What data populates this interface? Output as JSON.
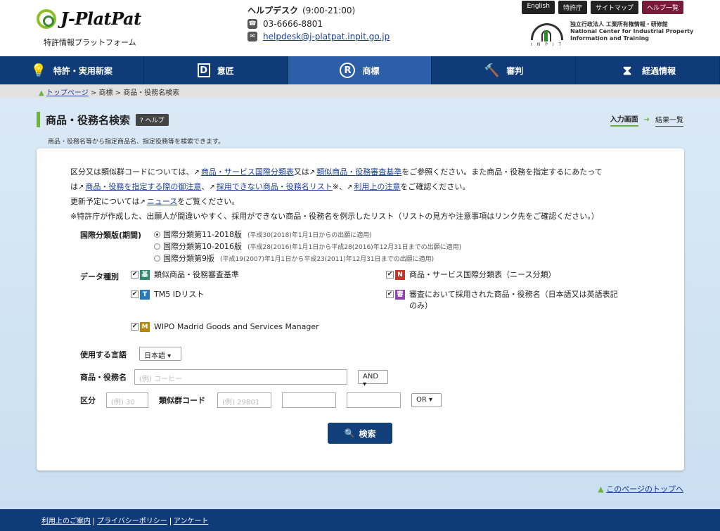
{
  "header": {
    "logo_text": "J-PlatPat",
    "logo_sub": "特許情報プラットフォーム",
    "helpdesk_title": "ヘルプデスク",
    "helpdesk_hours": "(9:00-21:00)",
    "phone": "03-6666-8801",
    "email": "helpdesk@j-platpat.inpit.go.jp",
    "util": [
      "English",
      "特許庁",
      "サイトマップ",
      "ヘルプ一覧"
    ],
    "inpit_line1": "独立行政法人 工業所有権情報・研修館",
    "inpit_line2": "National Center for Industrial Property",
    "inpit_line3": "Information and Training",
    "inpit_sub": "INPIT"
  },
  "nav": {
    "items": [
      {
        "label": "特許・実用新案",
        "icon": "lightbulb-icon"
      },
      {
        "label": "意匠",
        "icon": "design-d-icon"
      },
      {
        "label": "商標",
        "icon": "trademark-r-icon"
      },
      {
        "label": "審判",
        "icon": "gavel-icon"
      },
      {
        "label": "経過情報",
        "icon": "hourglass-icon"
      }
    ],
    "active_index": 2
  },
  "breadcrumb": {
    "home": "トップページ",
    "mid": "商標",
    "current": "商品・役務名検索"
  },
  "page": {
    "title": "商品・役務名検索",
    "help_label": "ヘルプ",
    "description": "商品・役務名等から指定商品名、指定役務等を検索できます。",
    "step_current": "入力画面",
    "step_next": "結果一覧"
  },
  "intro": {
    "p1_a": "区分又は類似群コードについては、",
    "link1": "商品・サービス国際分類表",
    "p1_b": "又は",
    "link2": "類似商品・役務審査基準",
    "p1_c": "をご参照ください。また商品・役務を指定するにあたって",
    "p2_a": "は",
    "link3": "商品・役務を指定する際の御注意",
    "p2_b": "、",
    "link4": "採用できない商品・役務名リスト",
    "p2_c": "※、",
    "link5": "利用上の注意",
    "p2_d": "をご確認ください。",
    "p3_a": "更新予定については",
    "link6": "ニュース",
    "p3_b": "をご覧ください。",
    "p4": "※特許庁が作成した、出願人が間違いやすく、採用ができない商品・役務名を例示したリスト（リストの見方や注意事項はリンク先をご確認ください。）"
  },
  "form": {
    "classification_label": "国際分類版(期間)",
    "editions": [
      {
        "label": "国際分類第11-2018版",
        "note": "(平成30(2018)年1月1日からの出願に適用)"
      },
      {
        "label": "国際分類第10-2016版",
        "note": "(平成28(2016)年1月1日から平成28(2016)年12月31日までの出願に適用)"
      },
      {
        "label": "国際分類第9版",
        "note": "(平成19(2007)年1月1日から平成23(2011)年12月31日までの出願に適用)"
      }
    ],
    "data_type_label": "データ種別",
    "data_types": [
      {
        "badge": "基",
        "label": "類似商品・役務審査基準",
        "color": "#2e8b6e"
      },
      {
        "badge": "N",
        "label": "商品・サービス国際分類表（ニース分類）",
        "color": "#c0392b"
      },
      {
        "badge": "T",
        "label": "TM5 IDリスト",
        "color": "#2a7ab8"
      },
      {
        "badge": "審",
        "label": "審査において採用された商品・役務名（日本語又は英語表記のみ）",
        "color": "#8e44ad"
      },
      {
        "badge": "M",
        "label": "WIPO Madrid Goods and Services Manager",
        "color": "#b8860b"
      }
    ],
    "language_label": "使用する言語",
    "language_value": "日本語 ▾",
    "name_label": "商品・役務名",
    "name_placeholder": "(例) コーヒー",
    "and_value": "AND ▾",
    "class_label": "区分",
    "class_placeholder": "(例) 30",
    "group_label": "類似群コード",
    "group_placeholder": "(例) 29B01",
    "or_value": "OR ▾",
    "search_label": "検索"
  },
  "to_top": "このページのトップへ",
  "footer": [
    "利用上のご案内",
    "プライバシーポリシー",
    "アンケート"
  ]
}
